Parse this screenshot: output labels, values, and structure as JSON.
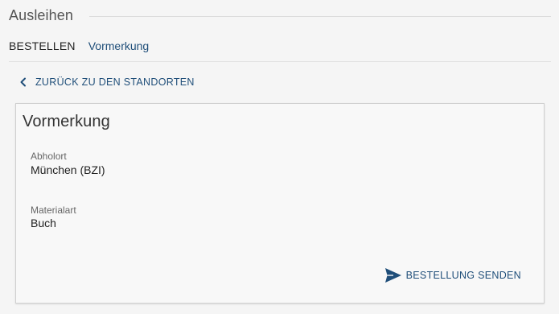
{
  "section": {
    "title": "Ausleihen"
  },
  "tabs": [
    {
      "label": "BESTELLEN"
    },
    {
      "label": "Vormerkung"
    }
  ],
  "back_link": {
    "label": "ZURÜCK ZU DEN STANDORTEN",
    "icon": "chevron-left-icon"
  },
  "form": {
    "title": "Vormerkung",
    "fields": [
      {
        "label": "Abholort",
        "value": "München (BZI)"
      },
      {
        "label": "Materialart",
        "value": "Buch"
      }
    ],
    "submit": {
      "label": "BESTELLUNG SENDEN",
      "icon": "send-icon"
    }
  },
  "colors": {
    "accent": "#1f4e79",
    "background": "#f5f5f5",
    "card_background": "#f8f8f8",
    "border": "#cfcfcf"
  }
}
